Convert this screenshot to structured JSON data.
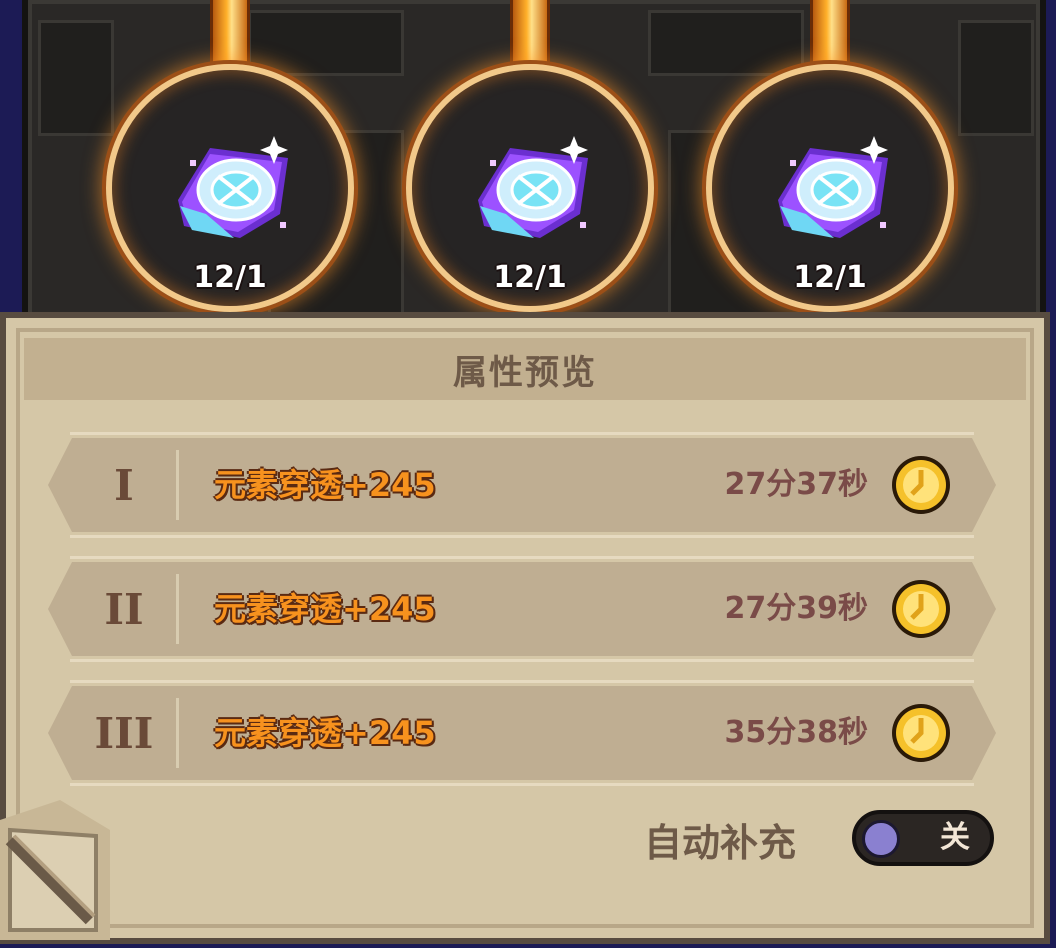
{
  "slots": [
    {
      "count": "12/1",
      "icon": "rune-crystal-icon"
    },
    {
      "count": "12/1",
      "icon": "rune-crystal-icon"
    },
    {
      "count": "12/1",
      "icon": "rune-crystal-icon"
    }
  ],
  "panel": {
    "title": "属性预览",
    "rows": [
      {
        "numeral": "I",
        "attribute": "元素穿透+245",
        "time": "27分37秒",
        "icon": "gold-coin-icon"
      },
      {
        "numeral": "II",
        "attribute": "元素穿透+245",
        "time": "27分39秒",
        "icon": "gold-coin-icon"
      },
      {
        "numeral": "III",
        "attribute": "元素穿透+245",
        "time": "35分38秒",
        "icon": "gold-coin-icon"
      }
    ],
    "auto_refill": {
      "label": "自动补充",
      "state": "关",
      "on": false
    }
  },
  "colors": {
    "background": "#1c1b55",
    "parchment": "#d5c7a7",
    "attribute_text": "#f7921e",
    "time_text": "#7a4b48",
    "ring_glow": "#ffb02a"
  }
}
